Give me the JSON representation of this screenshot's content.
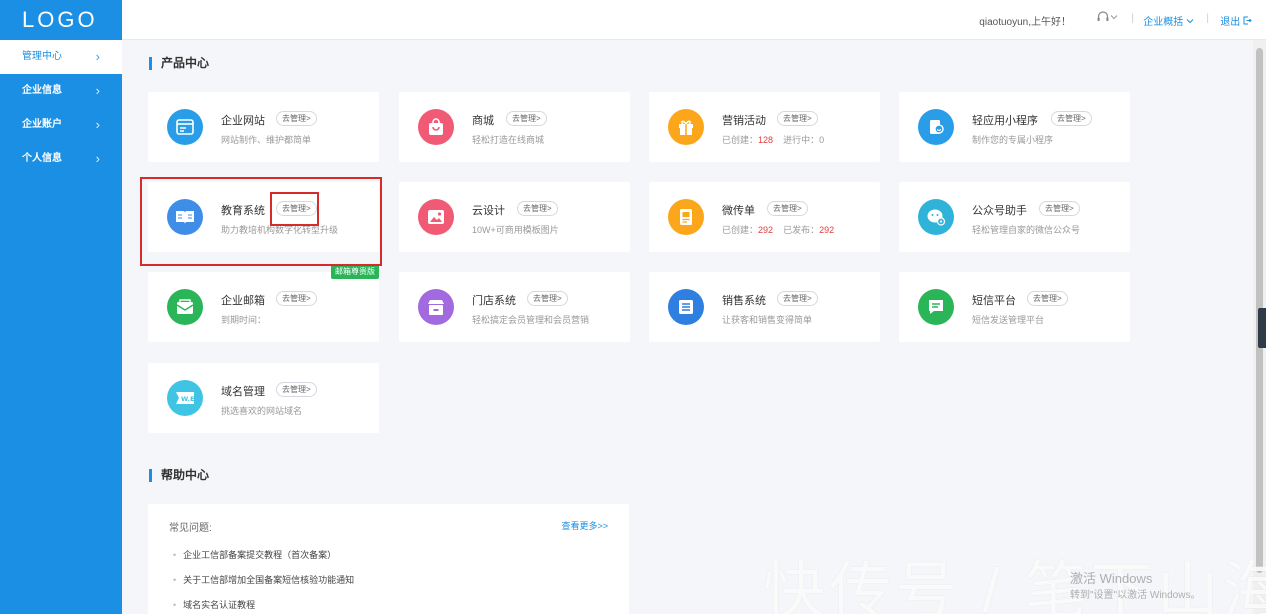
{
  "sidebar": {
    "logo": "LOGO",
    "items": [
      {
        "label": "管理中心"
      },
      {
        "label": "企业信息"
      },
      {
        "label": "企业账户"
      },
      {
        "label": "个人信息"
      }
    ],
    "chevron": "›"
  },
  "header": {
    "greeting": "qiaotuoyun,上午好！",
    "overview": "企业概括",
    "logout": "退出",
    "separator": "|"
  },
  "products": {
    "section_title": "产品中心",
    "manage_label": "去管理>",
    "cards": [
      {
        "title": "企业网站",
        "desc": "网站制作、维护都简单",
        "icon": "website-icon",
        "color": "#2a9de8"
      },
      {
        "title": "商城",
        "desc": "轻松打造在线商城",
        "icon": "shopping-bag-icon",
        "color": "#f15a75"
      },
      {
        "title": "营销活动",
        "desc_prefix": "已创建：",
        "num1": "128",
        "desc_mid": "进行中：",
        "num2": "0",
        "icon": "gift-icon",
        "color": "#fba61b"
      },
      {
        "title": "轻应用小程序",
        "desc": "制作您的专属小程序",
        "icon": "mini-program-icon",
        "color": "#2a9de8"
      },
      {
        "title": "教育系统",
        "desc": "助力教培机构数字化转型升级",
        "icon": "book-icon",
        "color": "#3e8ee8"
      },
      {
        "title": "云设计",
        "desc": "10W+可商用模板图片",
        "icon": "image-icon",
        "color": "#f15a75"
      },
      {
        "title": "微传单",
        "desc_prefix": "已创建：",
        "num1": "292",
        "desc_mid": "已发布：",
        "num2": "292",
        "icon": "flyer-icon",
        "color": "#fba61b"
      },
      {
        "title": "公众号助手",
        "desc": "轻松管理自家的微信公众号",
        "icon": "wechat-icon",
        "color": "#2fb3d9"
      },
      {
        "title": "企业邮箱",
        "desc": "到期时间：",
        "icon": "mail-icon",
        "color": "#2bb559",
        "badge": "邮箱尊贵版"
      },
      {
        "title": "门店系统",
        "desc": "轻松搞定会员管理和会员营销",
        "icon": "store-icon",
        "color": "#a36ae0"
      },
      {
        "title": "销售系统",
        "desc": "让获客和销售变得简单",
        "icon": "list-icon",
        "color": "#2f7fe0"
      },
      {
        "title": "短信平台",
        "desc": "短信发送管理平台",
        "icon": "sms-icon",
        "color": "#2bb559"
      },
      {
        "title": "域名管理",
        "desc": "挑选喜欢的网站域名",
        "icon": "domain-icon",
        "color": "#3fc5e3",
        "icon_text": "W.E"
      }
    ]
  },
  "help": {
    "section_title": "帮助中心",
    "faq_label": "常见问题:",
    "more": "查看更多>>",
    "questions": [
      "企业工信部备案提交教程（首次备案）",
      "关于工信部增加全国备案短信核验功能通知",
      "域名实名认证教程"
    ]
  },
  "watermark": {
    "main": "快传号 / 笔下山海",
    "activate": "激活 Windows",
    "activate_sub": "转到\"设置\"以激活 Windows。"
  }
}
